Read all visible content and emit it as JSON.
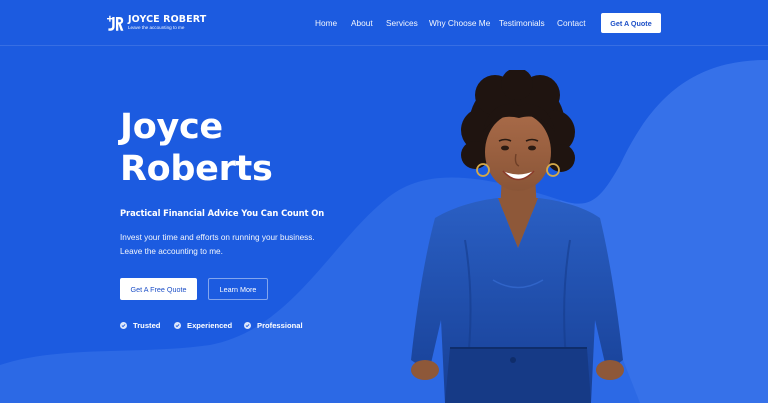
{
  "brand": {
    "name": "JOYCE ROBERT",
    "tagline": "Leave the accounting to me",
    "logo_icon": "jr-monogram-icon"
  },
  "nav": {
    "items": [
      {
        "label": "Home"
      },
      {
        "label": "About"
      },
      {
        "label": "Services"
      },
      {
        "label": "Why Choose Me"
      },
      {
        "label": "Testimonials"
      },
      {
        "label": "Contact"
      }
    ],
    "cta_label": "Get A Quote"
  },
  "hero": {
    "title_line1": "Joyce",
    "title_line2": "Roberts",
    "subtitle": "Practical Financial Advice You Can Count On",
    "description_line1": "Invest your time and efforts on running your business.",
    "description_line2": "Leave the accounting to me.",
    "primary_button": "Get A Free Quote",
    "secondary_button": "Learn More",
    "features": [
      {
        "label": "Trusted",
        "icon": "check-circle-icon"
      },
      {
        "label": "Experienced",
        "icon": "check-circle-icon"
      },
      {
        "label": "Professional",
        "icon": "check-circle-icon"
      }
    ],
    "portrait": "smiling woman with curly hair in blue blouse"
  },
  "colors": {
    "background": "#1c5be0",
    "wave": "#3d79ec",
    "button_text": "#1c4fc7",
    "blouse": "#1f4fae"
  }
}
